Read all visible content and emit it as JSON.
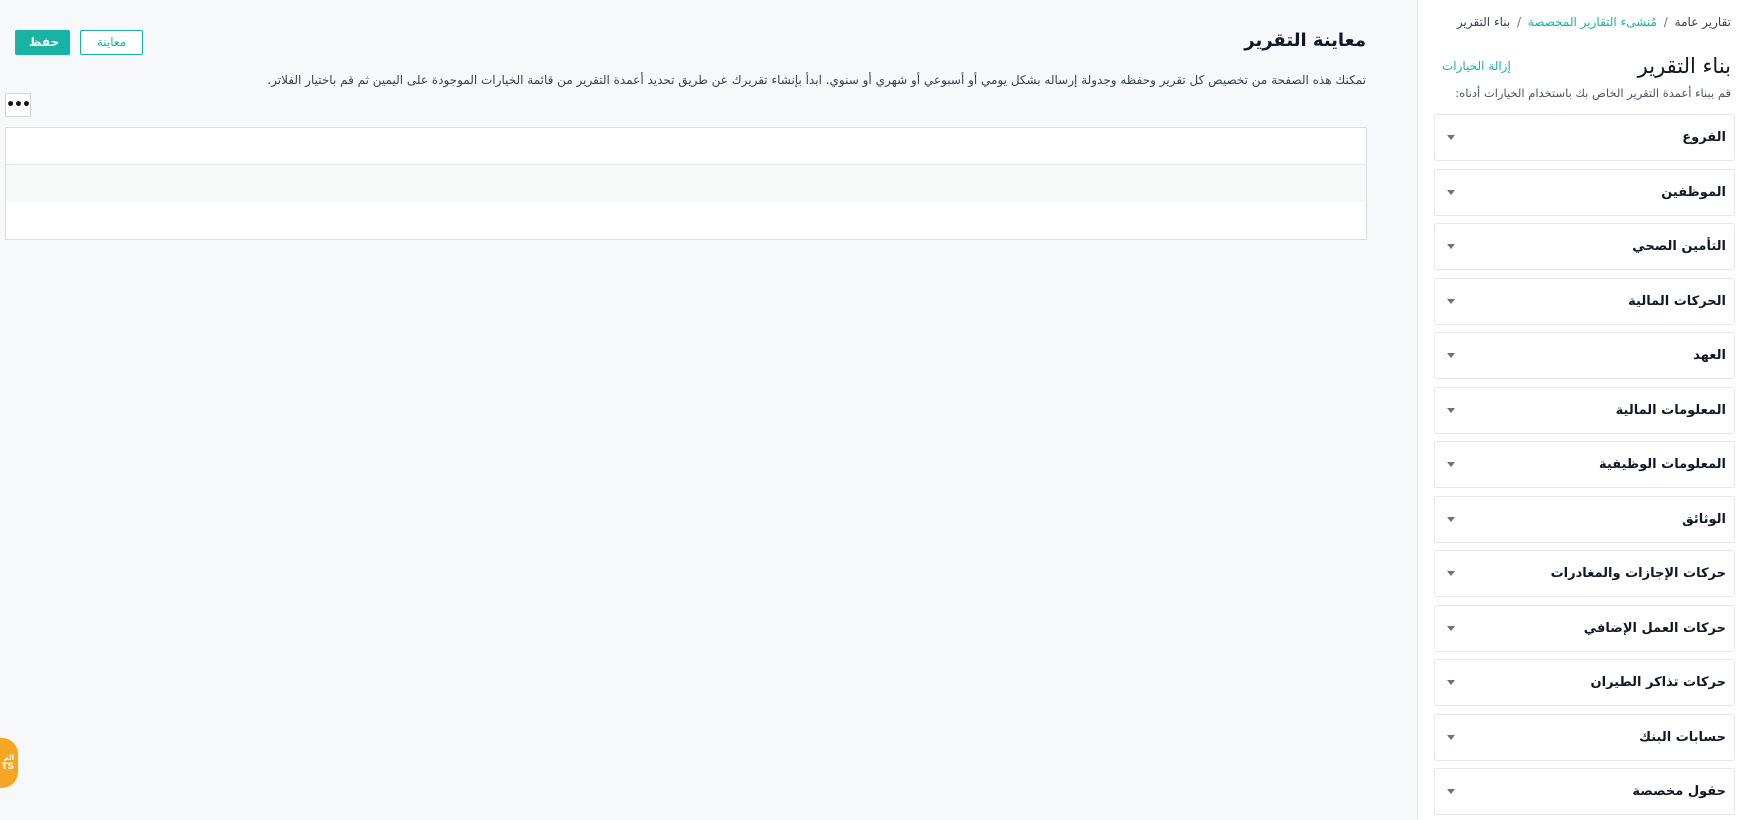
{
  "breadcrumb": {
    "root": "تقارير عامة",
    "middle": "مُنشىء التقارير المخصصة",
    "current": "بناء التقرير"
  },
  "builder": {
    "title": "بناء التقرير",
    "remove_label": "إزالة الخيارات",
    "hint": "قم ببناء أعمدة التقرير الخاص بك باستخدام الخيارات أدناه:",
    "sections": [
      {
        "label": "الفروع"
      },
      {
        "label": "الموظفين"
      },
      {
        "label": "التأمين الصحي"
      },
      {
        "label": "الحركات المالية"
      },
      {
        "label": "العهد"
      },
      {
        "label": "المعلومات المالية"
      },
      {
        "label": "المعلومات الوظيفية"
      },
      {
        "label": "الوثائق"
      },
      {
        "label": "حركات الإجازات والمغادرات"
      },
      {
        "label": "حركات العمل الإضافي"
      },
      {
        "label": "حركات تذاكر الطيران"
      },
      {
        "label": "حسابات البنك"
      },
      {
        "label": "حقول مخصصة"
      }
    ]
  },
  "main": {
    "title": "معاينة التقرير",
    "description": "تمكنك هذه الصفحة من تخصيص كل تقرير وحفظه وجدولة إرساله بشكل يومي أو أسبوعي أو شهري أو سنوي. ابدأ بإنشاء تقريرك عن طريق تحديد أعمدة التقرير من قائمة الخيارات الموجودة على اليمين ثم قم باختيار الفلاتر.",
    "preview_label": "معاينة",
    "save_label": "حفظ",
    "more_label": "•••"
  },
  "float_badge": {
    "line1": "الم",
    "line2": "TS"
  },
  "colors": {
    "accent": "#19b3a6",
    "badge": "#f5a623"
  }
}
